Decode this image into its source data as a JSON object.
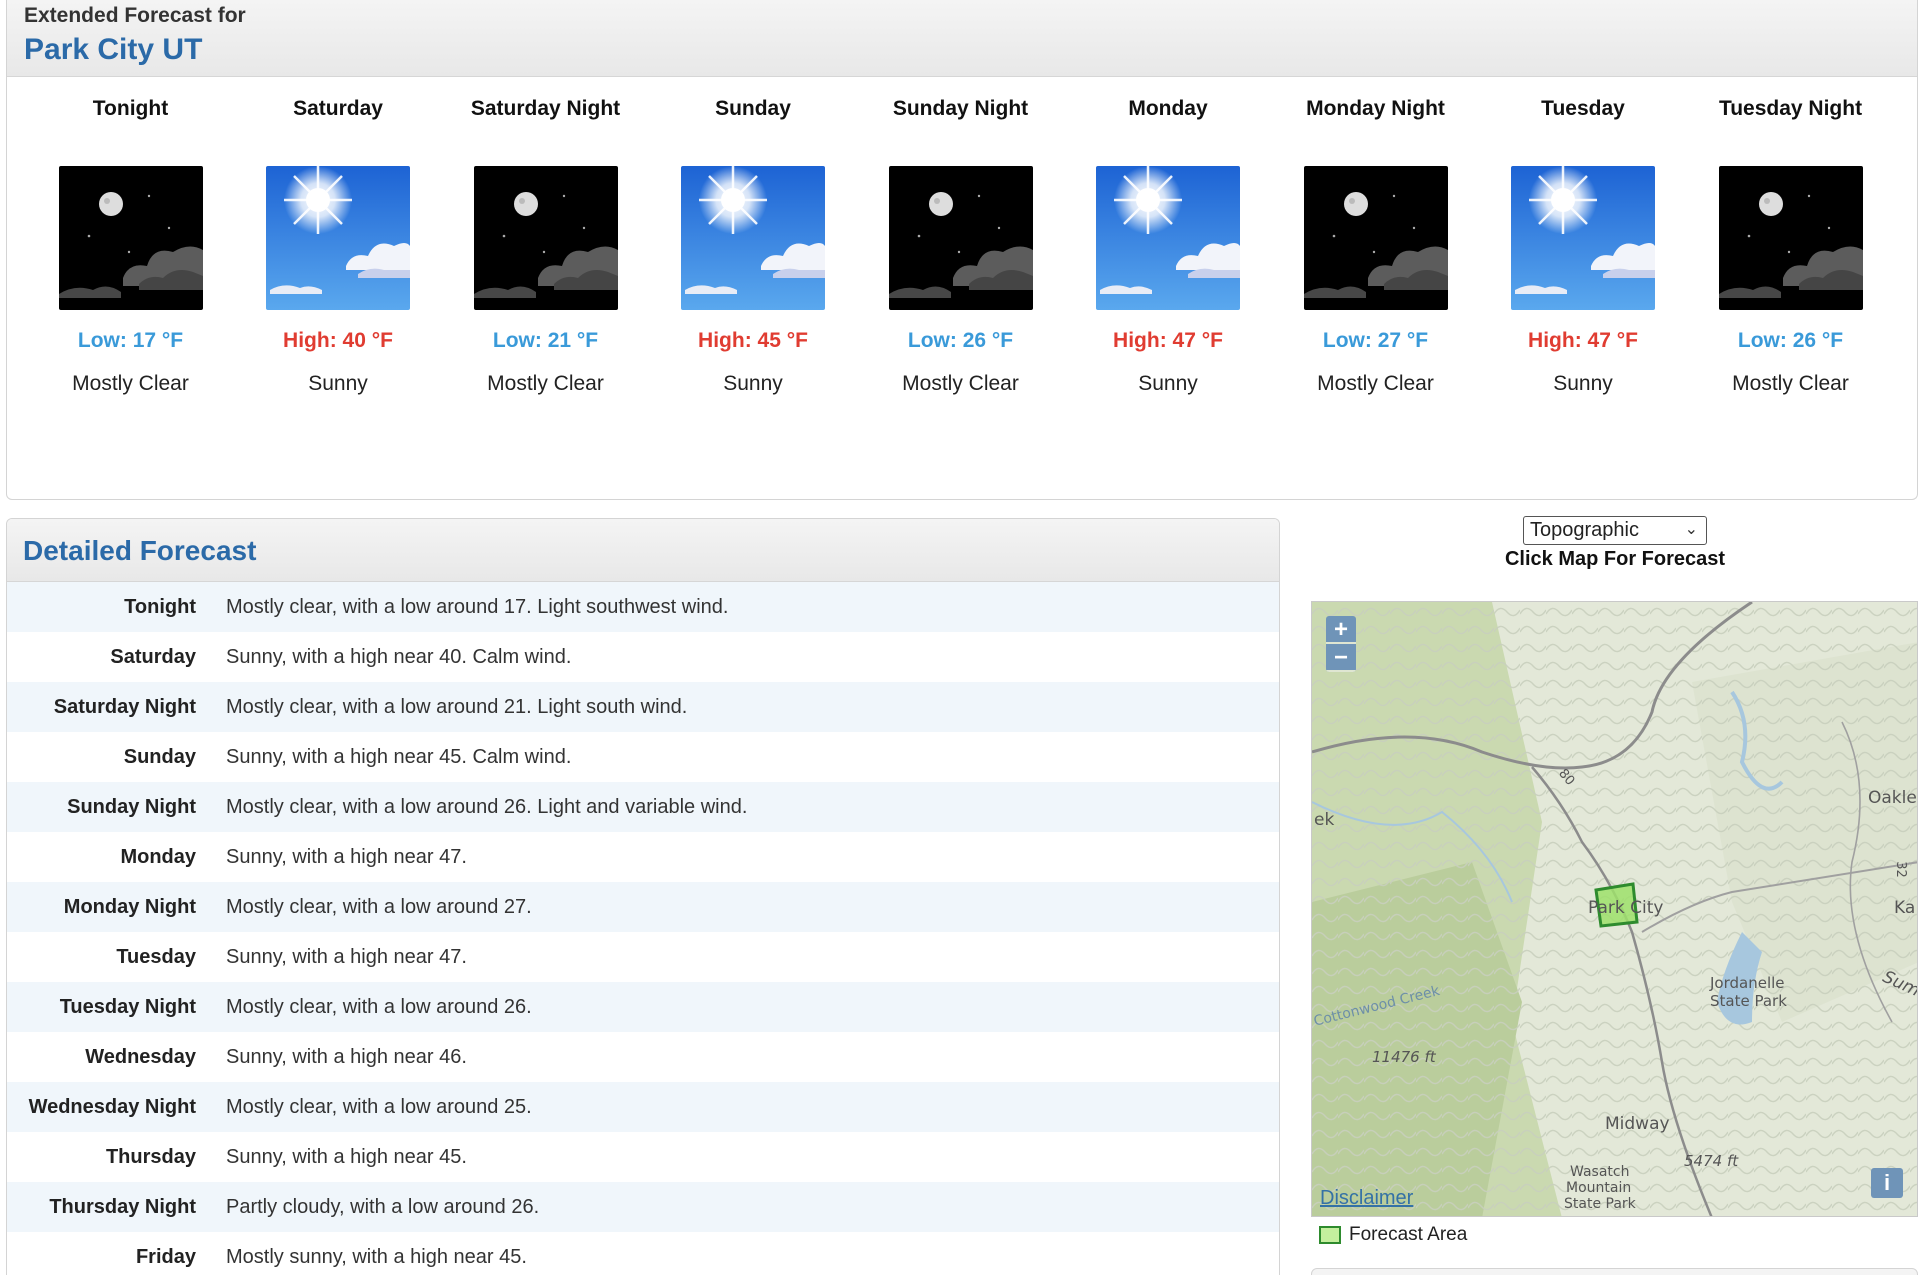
{
  "extended": {
    "heading": "Extended Forecast for",
    "location": "Park City UT",
    "periods": [
      {
        "name": "Tonight",
        "icon": "night-moon-clouds-icon",
        "temp": "Low: 17 °F",
        "kind": "low",
        "cond": "Mostly Clear"
      },
      {
        "name": "Saturday",
        "icon": "sun-icon",
        "temp": "High: 40 °F",
        "kind": "high",
        "cond": "Sunny"
      },
      {
        "name": "Saturday Night",
        "icon": "night-moon-clouds-icon",
        "temp": "Low: 21 °F",
        "kind": "low",
        "cond": "Mostly Clear"
      },
      {
        "name": "Sunday",
        "icon": "sun-icon",
        "temp": "High: 45 °F",
        "kind": "high",
        "cond": "Sunny"
      },
      {
        "name": "Sunday Night",
        "icon": "night-moon-clouds-icon",
        "temp": "Low: 26 °F",
        "kind": "low",
        "cond": "Mostly Clear"
      },
      {
        "name": "Monday",
        "icon": "sun-icon",
        "temp": "High: 47 °F",
        "kind": "high",
        "cond": "Sunny"
      },
      {
        "name": "Monday Night",
        "icon": "night-moon-clouds-icon",
        "temp": "Low: 27 °F",
        "kind": "low",
        "cond": "Mostly Clear"
      },
      {
        "name": "Tuesday",
        "icon": "sun-icon",
        "temp": "High: 47 °F",
        "kind": "high",
        "cond": "Sunny"
      },
      {
        "name": "Tuesday Night",
        "icon": "night-moon-clouds-icon",
        "temp": "Low: 26 °F",
        "kind": "low",
        "cond": "Mostly Clear"
      }
    ]
  },
  "detailed": {
    "title": "Detailed Forecast",
    "rows": [
      {
        "label": "Tonight",
        "text": "Mostly clear, with a low around 17. Light southwest wind."
      },
      {
        "label": "Saturday",
        "text": "Sunny, with a high near 40. Calm wind."
      },
      {
        "label": "Saturday Night",
        "text": "Mostly clear, with a low around 21. Light south wind."
      },
      {
        "label": "Sunday",
        "text": "Sunny, with a high near 45. Calm wind."
      },
      {
        "label": "Sunday Night",
        "text": "Mostly clear, with a low around 26. Light and variable wind."
      },
      {
        "label": "Monday",
        "text": "Sunny, with a high near 47."
      },
      {
        "label": "Monday Night",
        "text": "Mostly clear, with a low around 27."
      },
      {
        "label": "Tuesday",
        "text": "Sunny, with a high near 47."
      },
      {
        "label": "Tuesday Night",
        "text": "Mostly clear, with a low around 26."
      },
      {
        "label": "Wednesday",
        "text": "Sunny, with a high near 46."
      },
      {
        "label": "Wednesday Night",
        "text": "Mostly clear, with a low around 25."
      },
      {
        "label": "Thursday",
        "text": "Sunny, with a high near 45."
      },
      {
        "label": "Thursday Night",
        "text": "Partly cloudy, with a low around 26."
      },
      {
        "label": "Friday",
        "text": "Mostly sunny, with a high near 45."
      }
    ]
  },
  "map": {
    "layer_select": "Topographic",
    "click_label": "Click Map For Forecast",
    "zoom_in": "+",
    "zoom_out": "−",
    "disclaimer": "Disclaimer",
    "info": "i",
    "legend": "Forecast Area",
    "labels": {
      "park_city": "Park City",
      "oakley": "Oakle",
      "kamas": "Ka",
      "ek": "ek",
      "jordanelle": "Jordanelle",
      "state_park": "State Park",
      "cottonwood": "Cottonwood Creek",
      "elev1": "11476 ft",
      "elev2": "5474 ft",
      "midway": "Midway",
      "wasatch1": "Wasatch",
      "wasatch2": "Mountain",
      "wasatch3": "State Park",
      "hwy80": "80",
      "hwy32": "32",
      "sum": "Sum"
    }
  },
  "colors": {
    "heading_blue": "#2b6aa8",
    "low_temp": "#3a9ad9",
    "high_temp": "#e03c31",
    "row_alt": "#f0f6fb"
  }
}
